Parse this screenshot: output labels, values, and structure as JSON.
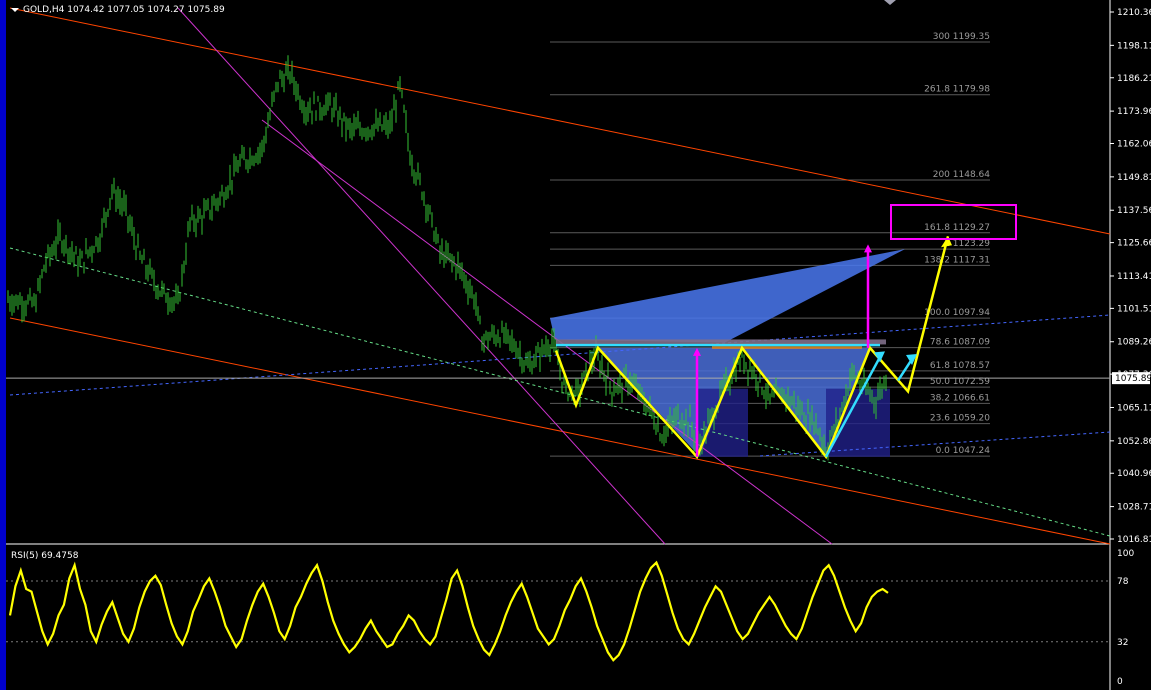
{
  "header": {
    "title": "GOLD,H4  1074.42 1077.05 1074.27 1075.89",
    "rsi_label": "RSI(5) 69.4758"
  },
  "colors": {
    "background": "#000000",
    "candle": "#33c233",
    "channel": "#ff4500",
    "magenta_line": "#cc33cc",
    "pattern": "#ffff00",
    "arrow_cyan": "#33ddff",
    "target_box": "#ff00ff",
    "triangle_fill": "#4a78f0",
    "rsi_line": "#ffff00"
  },
  "chart_data": [
    {
      "type": "line",
      "title": "GOLD,H4",
      "ylim": [
        1010,
        1216
      ],
      "y_ticks": [
        "1210.36",
        "1198.11",
        "1186.21",
        "1173.96",
        "1162.06",
        "1149.81",
        "1137.56",
        "1125.66",
        "1113.41",
        "1101.51",
        "1089.26",
        "1077.36",
        "1065.11",
        "1052.86",
        "1040.96",
        "1028.71",
        "1016.81"
      ],
      "current_price": "1075.89",
      "fib_levels": [
        {
          "label": "300 1199.35",
          "value": 1199.35
        },
        {
          "label": "261.8 1179.98",
          "value": 1179.98
        },
        {
          "label": "200 1148.64",
          "value": 1148.64
        },
        {
          "label": "161.8 1129.27",
          "value": 1129.27
        },
        {
          "label": "1 1123.29",
          "value": 1123.29
        },
        {
          "label": "138.2 1117.31",
          "value": 1117.31
        },
        {
          "label": "100.0 1097.94",
          "value": 1097.94
        },
        {
          "label": "78.6 1087.09",
          "value": 1087.09
        },
        {
          "label": "61.8 1078.57",
          "value": 1078.57
        },
        {
          "label": "50.0 1072.59",
          "value": 1072.59
        },
        {
          "label": "38.2 1066.61",
          "value": 1066.61
        },
        {
          "label": "23.6 1059.20",
          "value": 1059.2
        },
        {
          "label": "0.0 1047.24",
          "value": 1047.24
        }
      ],
      "price_path": [
        {
          "x": 8,
          "y": 1105
        },
        {
          "x": 35,
          "y": 1103
        },
        {
          "x": 45,
          "y": 1118
        },
        {
          "x": 60,
          "y": 1128
        },
        {
          "x": 80,
          "y": 1118
        },
        {
          "x": 100,
          "y": 1128
        },
        {
          "x": 112,
          "y": 1145
        },
        {
          "x": 125,
          "y": 1138
        },
        {
          "x": 140,
          "y": 1120
        },
        {
          "x": 160,
          "y": 1108
        },
        {
          "x": 178,
          "y": 1103
        },
        {
          "x": 190,
          "y": 1133
        },
        {
          "x": 205,
          "y": 1136
        },
        {
          "x": 222,
          "y": 1143
        },
        {
          "x": 240,
          "y": 1155
        },
        {
          "x": 262,
          "y": 1160
        },
        {
          "x": 278,
          "y": 1185
        },
        {
          "x": 290,
          "y": 1188
        },
        {
          "x": 305,
          "y": 1175
        },
        {
          "x": 330,
          "y": 1176
        },
        {
          "x": 350,
          "y": 1167
        },
        {
          "x": 372,
          "y": 1168
        },
        {
          "x": 390,
          "y": 1168
        },
        {
          "x": 400,
          "y": 1183
        },
        {
          "x": 410,
          "y": 1158
        },
        {
          "x": 425,
          "y": 1142
        },
        {
          "x": 440,
          "y": 1122
        },
        {
          "x": 458,
          "y": 1117
        },
        {
          "x": 475,
          "y": 1105
        },
        {
          "x": 482,
          "y": 1090
        },
        {
          "x": 500,
          "y": 1092
        },
        {
          "x": 515,
          "y": 1088
        },
        {
          "x": 528,
          "y": 1080
        },
        {
          "x": 540,
          "y": 1085
        },
        {
          "x": 552,
          "y": 1090
        },
        {
          "x": 565,
          "y": 1072
        },
        {
          "x": 578,
          "y": 1070
        },
        {
          "x": 595,
          "y": 1085
        },
        {
          "x": 612,
          "y": 1072
        },
        {
          "x": 630,
          "y": 1075
        },
        {
          "x": 650,
          "y": 1064
        },
        {
          "x": 662,
          "y": 1055
        },
        {
          "x": 678,
          "y": 1062
        },
        {
          "x": 690,
          "y": 1060
        },
        {
          "x": 698,
          "y": 1050
        },
        {
          "x": 712,
          "y": 1062
        },
        {
          "x": 728,
          "y": 1075
        },
        {
          "x": 742,
          "y": 1083
        },
        {
          "x": 755,
          "y": 1078
        },
        {
          "x": 770,
          "y": 1068
        },
        {
          "x": 785,
          "y": 1070
        },
        {
          "x": 800,
          "y": 1064
        },
        {
          "x": 815,
          "y": 1060
        },
        {
          "x": 826,
          "y": 1050
        },
        {
          "x": 838,
          "y": 1060
        },
        {
          "x": 852,
          "y": 1078
        },
        {
          "x": 864,
          "y": 1072
        },
        {
          "x": 876,
          "y": 1068
        },
        {
          "x": 886,
          "y": 1076
        }
      ],
      "pattern_points": [
        {
          "x": 556,
          "y": 1086
        },
        {
          "x": 576,
          "y": 1066
        },
        {
          "x": 598,
          "y": 1087
        },
        {
          "x": 697,
          "y": 1047
        },
        {
          "x": 742,
          "y": 1087
        },
        {
          "x": 826,
          "y": 1047
        },
        {
          "x": 870,
          "y": 1087
        },
        {
          "x": 908,
          "y": 1071
        },
        {
          "x": 948,
          "y": 1128
        }
      ]
    },
    {
      "type": "line",
      "title": "RSI(5) 69.4758",
      "ylim": [
        0,
        100
      ],
      "y_ticks": [
        "100",
        "78",
        "32",
        "0"
      ],
      "values": [
        52,
        74,
        86,
        72,
        70,
        55,
        40,
        30,
        38,
        52,
        60,
        80,
        90,
        72,
        60,
        40,
        32,
        45,
        55,
        62,
        50,
        38,
        32,
        42,
        58,
        70,
        78,
        82,
        75,
        60,
        46,
        36,
        30,
        40,
        55,
        64,
        74,
        80,
        70,
        58,
        44,
        36,
        28,
        34,
        48,
        60,
        70,
        76,
        66,
        54,
        40,
        34,
        44,
        58,
        66,
        76,
        84,
        90,
        78,
        62,
        48,
        38,
        30,
        24,
        28,
        34,
        42,
        48,
        40,
        34,
        28,
        30,
        38,
        44,
        52,
        48,
        40,
        34,
        30,
        36,
        50,
        64,
        80,
        86,
        74,
        58,
        44,
        34,
        26,
        22,
        30,
        40,
        52,
        62,
        70,
        76,
        66,
        54,
        42,
        36,
        30,
        34,
        44,
        56,
        64,
        74,
        80,
        70,
        58,
        44,
        34,
        24,
        18,
        22,
        30,
        42,
        56,
        70,
        80,
        88,
        92,
        82,
        68,
        54,
        42,
        34,
        30,
        38,
        48,
        58,
        66,
        74,
        70,
        60,
        50,
        40,
        34,
        38,
        46,
        54,
        60,
        66,
        60,
        52,
        44,
        38,
        34,
        42,
        54,
        66,
        76,
        86,
        90,
        82,
        70,
        58,
        48,
        40,
        46,
        58,
        66,
        70,
        72,
        69
      ]
    }
  ]
}
